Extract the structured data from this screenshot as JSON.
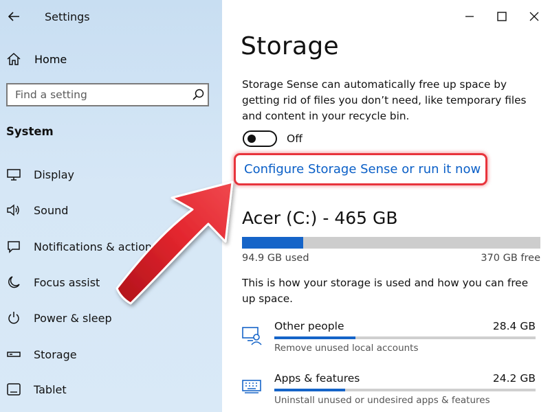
{
  "app_title": "Settings",
  "sidebar": {
    "home_label": "Home",
    "search_placeholder": "Find a setting",
    "section_title": "System",
    "items": [
      {
        "label": "Display",
        "icon": "display-icon"
      },
      {
        "label": "Sound",
        "icon": "sound-icon"
      },
      {
        "label": "Notifications & actions",
        "icon": "notifications-icon"
      },
      {
        "label": "Focus assist",
        "icon": "moon-icon"
      },
      {
        "label": "Power & sleep",
        "icon": "power-icon"
      },
      {
        "label": "Storage",
        "icon": "storage-icon"
      },
      {
        "label": "Tablet",
        "icon": "tablet-icon"
      }
    ]
  },
  "main": {
    "title": "Storage",
    "description": "Storage Sense can automatically free up space by getting rid of files you don’t need, like temporary files and content in your recycle bin.",
    "toggle_state": "Off",
    "configure_link": "Configure Storage Sense or run it now",
    "drive": {
      "title": "Acer (C:) - 465 GB",
      "used_label": "94.9 GB used",
      "free_label": "370 GB free",
      "used_fraction": 0.204
    },
    "storage_description": "This is how your storage is used and how you can free up space.",
    "categories": [
      {
        "name": "Other people",
        "size": "28.4 GB",
        "sub": "Remove unused local accounts",
        "fill_fraction": 0.31,
        "icon": "people-icon"
      },
      {
        "name": "Apps & features",
        "size": "24.2 GB",
        "sub": "Uninstall unused or undesired apps & features",
        "fill_fraction": 0.27,
        "icon": "keyboard-icon"
      }
    ]
  },
  "colors": {
    "accent": "#1564c8",
    "link": "#0a5fc7",
    "highlight_red": "#e8343c",
    "sidebar_bg": "#d6e7f6"
  }
}
